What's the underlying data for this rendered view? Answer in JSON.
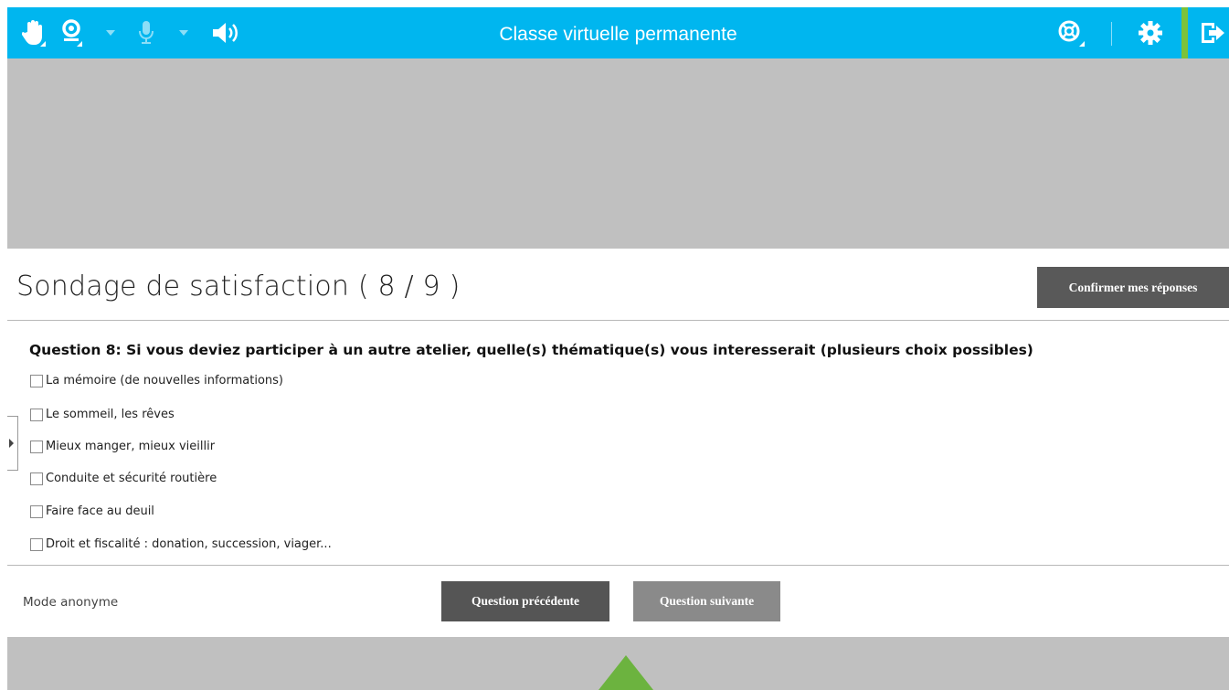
{
  "app": {
    "title": "Classe virtuelle permanente",
    "accent_color": "#00b6ef",
    "active_indicator_color": "#7cc23a"
  },
  "toolbar": {
    "left_icons": [
      "raise-hand-icon",
      "webcam-icon",
      "microphone-icon",
      "speaker-icon"
    ],
    "right_icons": [
      "support-icon",
      "settings-icon",
      "exit-icon"
    ]
  },
  "survey": {
    "title": "Sondage de satisfaction ( 8 / 9 )",
    "confirm_label": "Confirmer mes réponses",
    "question": "Question 8: Si vous deviez participer à un autre atelier, quelle(s) thématique(s) vous interesserait (plusieurs choix possibles)",
    "options": [
      {
        "label": "La mémoire (de nouvelles informations)",
        "checked": false
      },
      {
        "label": "Le sommeil, les rêves",
        "checked": false
      },
      {
        "label": "Mieux manger, mieux vieillir",
        "checked": false
      },
      {
        "label": "Conduite et sécurité routière",
        "checked": false
      },
      {
        "label": "Faire face au deuil",
        "checked": false
      },
      {
        "label": "Droit et fiscalité : donation, succession, viager...",
        "checked": false
      }
    ],
    "anonymous_label": "Mode anonyme",
    "prev_label": "Question précédente",
    "next_label": "Question suivante"
  }
}
